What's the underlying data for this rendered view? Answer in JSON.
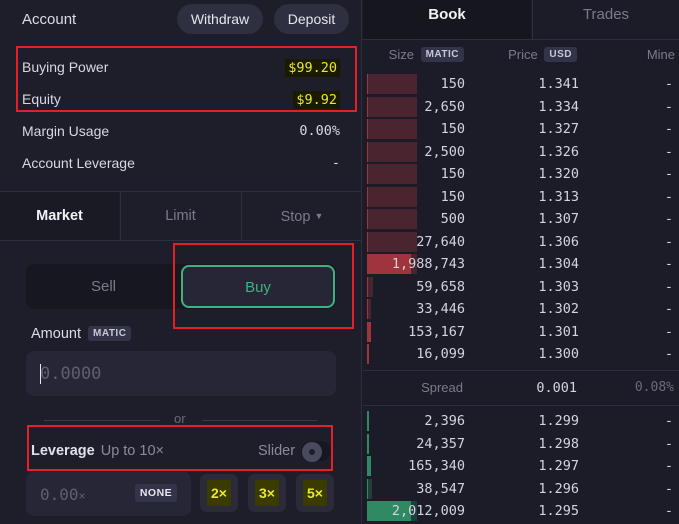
{
  "account": {
    "title": "Account",
    "withdraw_label": "Withdraw",
    "deposit_label": "Deposit",
    "stats": [
      {
        "label": "Buying Power",
        "value": "$99.20"
      },
      {
        "label": "Equity",
        "value": "$9.92"
      },
      {
        "label": "Margin Usage",
        "value": "0.00%"
      },
      {
        "label": "Account Leverage",
        "value": "-"
      }
    ]
  },
  "order_types": {
    "tabs": [
      {
        "label": "Market",
        "active": true
      },
      {
        "label": "Limit",
        "active": false
      },
      {
        "label": "Stop",
        "active": false,
        "dropdown": true
      }
    ],
    "caret": "▼"
  },
  "side": {
    "sell_label": "Sell",
    "buy_label": "Buy",
    "selected": "Buy",
    "buy_color": "#3fb27f"
  },
  "amount": {
    "label": "Amount",
    "unit": "MATIC",
    "placeholder": "0.0000",
    "value": ""
  },
  "or_text": "or",
  "leverage": {
    "label": "Leverage",
    "sublabel": "Up to 10×",
    "slider_label": "Slider",
    "value": "0.00",
    "suffix": "×",
    "none_label": "NONE",
    "presets": [
      "2×",
      "3×",
      "5×"
    ]
  },
  "book": {
    "tabs": [
      {
        "label": "Book",
        "active": true
      },
      {
        "label": "Trades",
        "active": false
      }
    ],
    "columns": {
      "size": "Size",
      "size_unit": "MATIC",
      "price": "Price",
      "price_unit": "USD",
      "mine": "Mine"
    },
    "asks": [
      {
        "size": "150",
        "price": "1.341",
        "mine": "-",
        "cum_fill": 1.0,
        "size_fill": 0.0
      },
      {
        "size": "2,650",
        "price": "1.334",
        "mine": "-",
        "cum_fill": 1.0,
        "size_fill": 0.0
      },
      {
        "size": "150",
        "price": "1.327",
        "mine": "-",
        "cum_fill": 1.0,
        "size_fill": 0.0
      },
      {
        "size": "2,500",
        "price": "1.326",
        "mine": "-",
        "cum_fill": 1.0,
        "size_fill": 0.0
      },
      {
        "size": "150",
        "price": "1.320",
        "mine": "-",
        "cum_fill": 1.0,
        "size_fill": 0.0
      },
      {
        "size": "150",
        "price": "1.313",
        "mine": "-",
        "cum_fill": 1.0,
        "size_fill": 0.0
      },
      {
        "size": "500",
        "price": "1.307",
        "mine": "-",
        "cum_fill": 1.0,
        "size_fill": 0.0
      },
      {
        "size": "27,640",
        "price": "1.306",
        "mine": "-",
        "cum_fill": 1.0,
        "size_fill": 0.0
      },
      {
        "size": "1,988,743",
        "price": "1.304",
        "mine": "-",
        "cum_fill": 1.0,
        "size_fill": 0.88
      },
      {
        "size": "59,658",
        "price": "1.303",
        "mine": "-",
        "cum_fill": 0.11,
        "size_fill": 0.0
      },
      {
        "size": "33,446",
        "price": "1.302",
        "mine": "-",
        "cum_fill": 0.07,
        "size_fill": 0.0
      },
      {
        "size": "153,167",
        "price": "1.301",
        "mine": "-",
        "cum_fill": 0.07,
        "size_fill": 0.07
      },
      {
        "size": "16,099",
        "price": "1.300",
        "mine": "-",
        "cum_fill": 0.01,
        "size_fill": 0.01
      }
    ],
    "spread": {
      "label": "Spread",
      "value": "0.001",
      "percent": "0.08%"
    },
    "bids": [
      {
        "size": "2,396",
        "price": "1.299",
        "mine": "-",
        "cum_fill": 0.01,
        "size_fill": 0.01
      },
      {
        "size": "24,357",
        "price": "1.298",
        "mine": "-",
        "cum_fill": 0.01,
        "size_fill": 0.01
      },
      {
        "size": "165,340",
        "price": "1.297",
        "mine": "-",
        "cum_fill": 0.08,
        "size_fill": 0.08
      },
      {
        "size": "38,547",
        "price": "1.296",
        "mine": "-",
        "cum_fill": 0.1,
        "size_fill": 0.0
      },
      {
        "size": "2,012,009",
        "price": "1.295",
        "mine": "-",
        "cum_fill": 1.0,
        "size_fill": 0.88
      }
    ],
    "ask_color": "#a0343c",
    "ask_depth_color": "#4a2530",
    "bid_color": "#2f8a64",
    "bid_depth_color": "#1f3f38"
  }
}
